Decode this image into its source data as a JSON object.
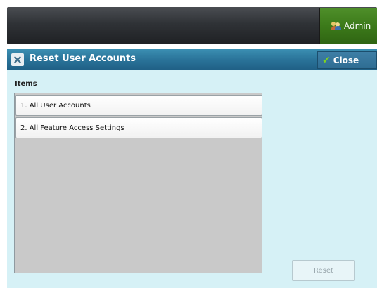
{
  "header": {
    "admin_label": "Admin"
  },
  "dialog": {
    "title": "Reset User Accounts",
    "close_label": "Close",
    "items_label": "Items",
    "items": [
      {
        "label": "1. All User Accounts"
      },
      {
        "label": "2. All Feature Access Settings"
      }
    ],
    "reset_label": "Reset"
  },
  "colors": {
    "title_bar": "#2a7399",
    "dialog_bg": "#d6f1f6",
    "admin_green": "#3c7a1a",
    "list_bg": "#c9c9c9",
    "check_green": "#7ed321"
  },
  "icons": {
    "admin": "admin-users-icon",
    "title": "tools-icon",
    "close": "check-icon"
  }
}
